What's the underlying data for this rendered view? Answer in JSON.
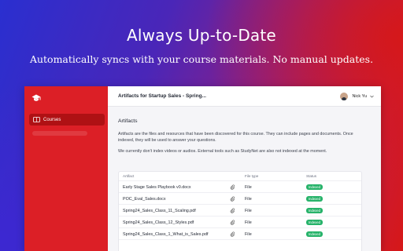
{
  "hero": {
    "headline": "Always Up-to-Date",
    "subheadline": "Automatically syncs with your course materials. No manual updates."
  },
  "sidebar": {
    "logo_icon": "graduation-cap-icon",
    "items": [
      {
        "label": "Courses",
        "icon": "book-icon",
        "active": true
      }
    ]
  },
  "topbar": {
    "title": "Artifacts for Startup Sales - Spring...",
    "user_name": "Nick Yu"
  },
  "artifacts": {
    "heading": "Artifacts",
    "description_1": "Artifacts are the files and resources that have been discovered for this course. They can include pages and documents. Once indexed, they will be used to answer your questions.",
    "description_2": "We currently don't index videos or audios. External tools such as StudyNet are also not indexed at the moment.",
    "columns": {
      "artifact": "Artifact",
      "file_type": "File type",
      "status": "Status"
    },
    "rows": [
      {
        "name": "Early Stage Sales Playbook v0.docx",
        "type": "File",
        "status": "Indexed"
      },
      {
        "name": "POC_Eval_Sales.docx",
        "type": "File",
        "status": "Indexed"
      },
      {
        "name": "Spring24_Sales_Class_11_Scaling.pdf",
        "type": "File",
        "status": "Indexed"
      },
      {
        "name": "Spring24_Sales_Class_12_Styles.pdf",
        "type": "File",
        "status": "Indexed"
      },
      {
        "name": "Spring24_Sales_Class_1_What_is_Sales.pdf",
        "type": "File",
        "status": "Indexed"
      }
    ]
  },
  "colors": {
    "sidebar": "#dc1f26",
    "badge": "#27b36a"
  }
}
